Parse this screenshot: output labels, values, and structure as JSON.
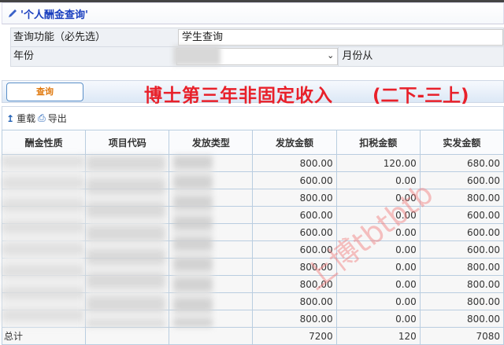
{
  "title": "'个人酬金查询'",
  "form": {
    "function_label": "查询功能（必先选）",
    "function_value": "学生查询",
    "year_label": "年份",
    "month_from_label": "月份从"
  },
  "query_button": "查询",
  "banner": {
    "main": "博士第三年非固定收入",
    "sub": "(二下-三上)"
  },
  "toolbar": {
    "reload": "重载",
    "export": "导出"
  },
  "table": {
    "headers": [
      "酬金性质",
      "项目代码",
      "发放类型",
      "发放金额",
      "扣税金额",
      "实发金额"
    ],
    "rows": [
      [
        "800.00",
        "120.00",
        "680.00"
      ],
      [
        "600.00",
        "0.00",
        "600.00"
      ],
      [
        "800.00",
        "0.00",
        "800.00"
      ],
      [
        "600.00",
        "0.00",
        "600.00"
      ],
      [
        "600.00",
        "0.00",
        "600.00"
      ],
      [
        "600.00",
        "0.00",
        "600.00"
      ],
      [
        "800.00",
        "0.00",
        "800.00"
      ],
      [
        "800.00",
        "0.00",
        "800.00"
      ],
      [
        "800.00",
        "0.00",
        "800.00"
      ],
      [
        "800.00",
        "0.00",
        "800.00"
      ]
    ],
    "total": {
      "label": "总计",
      "values": [
        "7200",
        "120",
        "7080"
      ]
    }
  },
  "watermark": "上博tbtbtb"
}
